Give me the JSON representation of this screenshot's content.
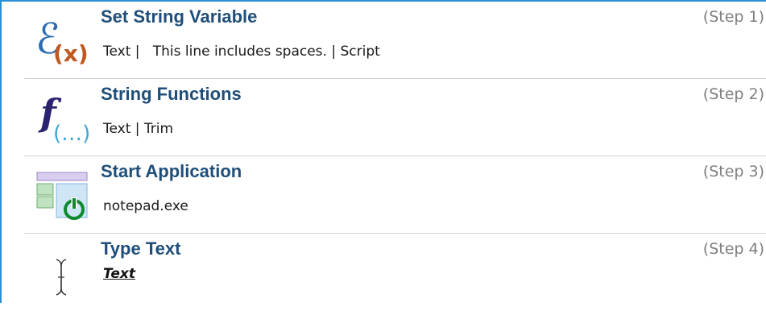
{
  "steps": [
    {
      "title": "Set String Variable",
      "number": "(Step 1)",
      "icon": "set-variable-icon",
      "detail": [
        {
          "text": "Text |"
        },
        {
          "text": "This line includes spaces. | Script"
        }
      ]
    },
    {
      "title": "String Functions",
      "number": "(Step 2)",
      "icon": "function-icon",
      "detail": [
        {
          "text": "Text |"
        },
        {
          "text": "Trim"
        }
      ]
    },
    {
      "title": "Start Application",
      "number": "(Step 3)",
      "icon": "start-application-icon",
      "detail": [
        {
          "text": "notepad.exe"
        }
      ]
    },
    {
      "title": "Type Text",
      "number": "(Step 4)",
      "icon": "text-cursor-icon",
      "variable": "Text"
    }
  ],
  "colors": {
    "frame_border": "#2a8fd4",
    "title": "#1f4e79",
    "step_number": "#7f7f7f",
    "divider": "#cfcfcf"
  }
}
